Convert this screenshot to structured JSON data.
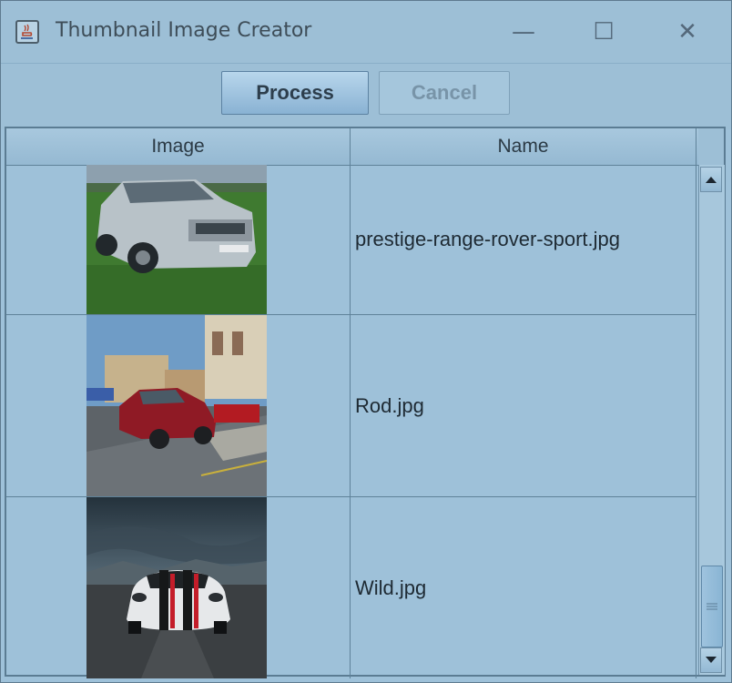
{
  "window": {
    "title": "Thumbnail Image Creator",
    "icon": "java-cup-icon",
    "controls": {
      "minimize": "—",
      "maximize": "☐",
      "close": "✕"
    }
  },
  "toolbar": {
    "process_label": "Process",
    "cancel_label": "Cancel"
  },
  "table": {
    "columns": [
      "Image",
      "Name"
    ],
    "rows": [
      {
        "thumbnail": "silver-suv-photo",
        "name": "prestige-range-rover-sport.jpg"
      },
      {
        "thumbnail": "red-hot-rod-street-photo",
        "name": "Rod.jpg"
      },
      {
        "thumbnail": "white-sports-car-photo",
        "name": "Wild.jpg"
      }
    ]
  },
  "scrollbar": {
    "up_icon": "arrow-up-icon",
    "down_icon": "arrow-down-icon",
    "grip_icon": "grip-icon"
  }
}
